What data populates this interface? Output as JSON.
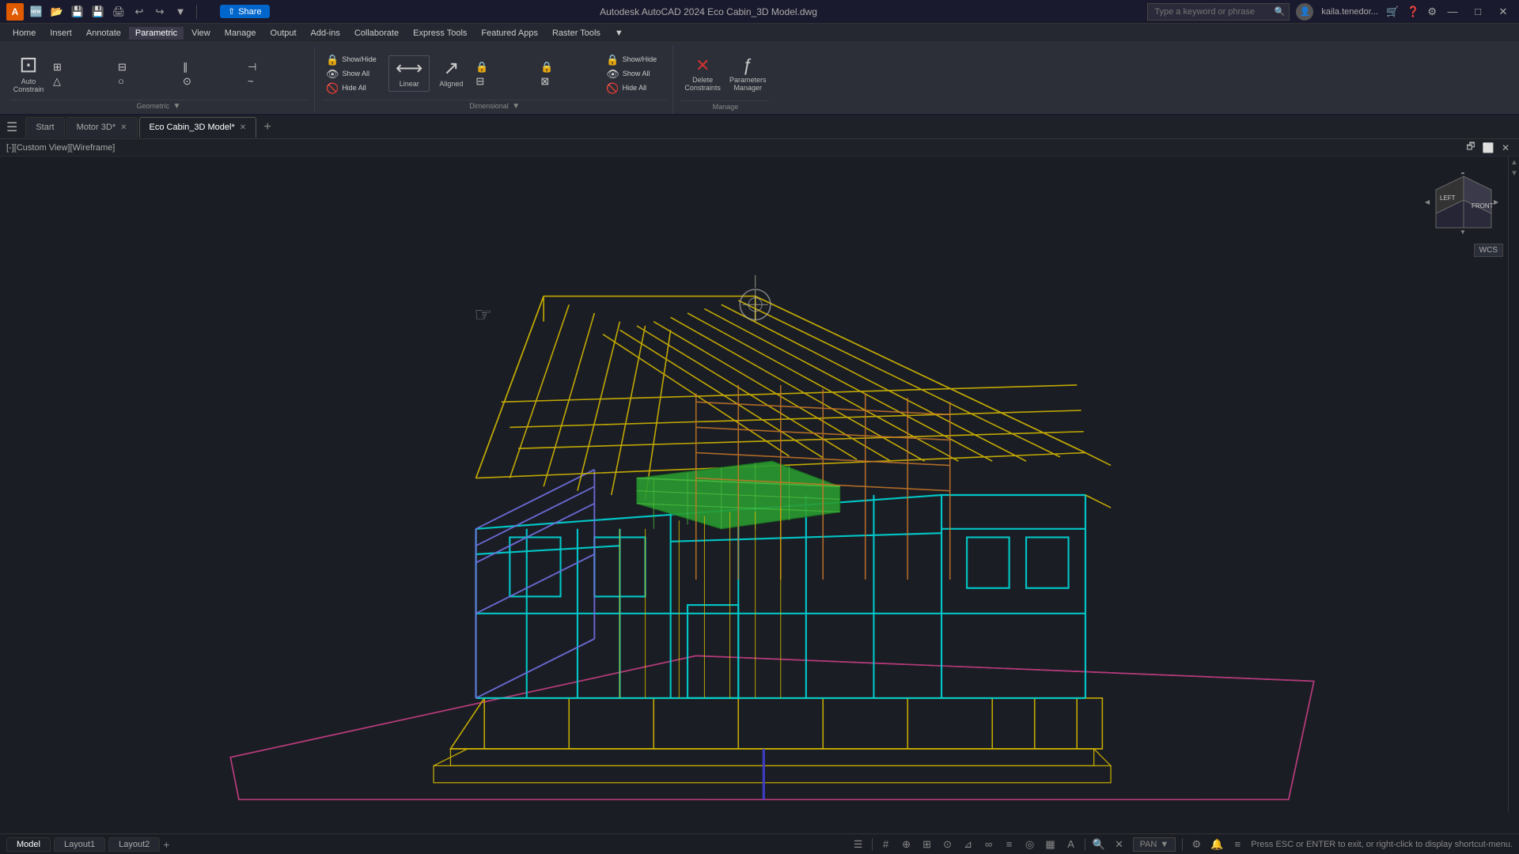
{
  "titlebar": {
    "app_icon": "A",
    "title": "Autodesk AutoCAD 2024  Eco Cabin_3D Model.dwg",
    "search_placeholder": "Type a keyword or phrase",
    "share_label": "Share",
    "user_label": "kaila.tenedor...",
    "minimize": "—",
    "maximize": "□",
    "close": "✕"
  },
  "qat": {
    "buttons": [
      "🆕",
      "📂",
      "💾",
      "💾",
      "🖨",
      "↩",
      "↩",
      "🔙",
      "🔜",
      "↕",
      "⟩"
    ]
  },
  "menubar": {
    "items": [
      "Home",
      "Insert",
      "Annotate",
      "Parametric",
      "View",
      "Manage",
      "Output",
      "Add-ins",
      "Collaborate",
      "Express Tools",
      "Featured Apps",
      "Raster Tools",
      "..."
    ]
  },
  "ribbon": {
    "active_tab": "Parametric",
    "groups": [
      {
        "label": "Geometric",
        "buttons": [
          {
            "icon": "⊡",
            "label": "Auto\nConstrain"
          },
          {
            "icon": "⊞",
            "label": ""
          },
          {
            "icon": "⊟",
            "label": ""
          },
          {
            "icon": "⊠",
            "label": ""
          }
        ],
        "has_expand": true
      },
      {
        "label": "Dimensional",
        "show_hide_label": "Show/Hide",
        "show_all_label": "Show All",
        "hide_all_label": "Hide All",
        "linear_label": "Linear",
        "aligned_label": "Aligned",
        "has_expand": true
      },
      {
        "label": "Manage",
        "delete_label": "Delete\nConstraints",
        "parameters_label": "Parameters\nManager"
      }
    ]
  },
  "tabs": {
    "items": [
      {
        "label": "Start",
        "closable": false,
        "active": false
      },
      {
        "label": "Motor 3D*",
        "closable": true,
        "active": false
      },
      {
        "label": "Eco Cabin_3D Model*",
        "closable": true,
        "active": true
      }
    ],
    "add_label": "+"
  },
  "viewlabel": {
    "text": "[-][Custom View][Wireframe]"
  },
  "viewport_cube": {
    "left_label": "LEFT",
    "front_label": "FRONT"
  },
  "wcs": {
    "label": "WCS"
  },
  "statusbar": {
    "model_tab": "Model",
    "layout1_tab": "Layout1",
    "layout2_tab": "Layout2",
    "add_label": "+",
    "status_message": "Press ESC or ENTER to exit, or right-click to display shortcut-menu.",
    "pan_label": "PAN"
  },
  "canvas": {
    "background": "#1a1d24"
  }
}
